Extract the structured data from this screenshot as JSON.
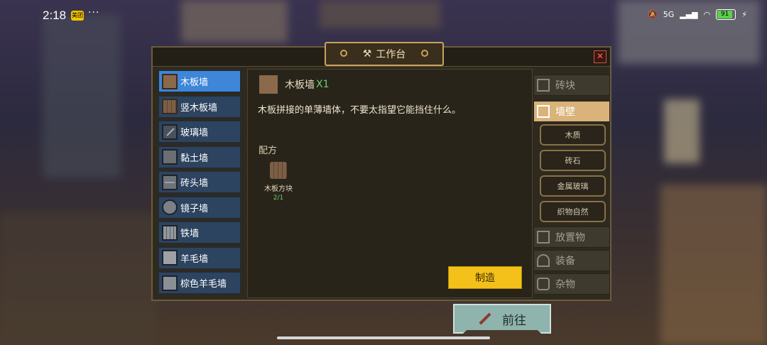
{
  "status_bar": {
    "time": "2:18",
    "app_badge": "美团",
    "more": "···",
    "network": "5G",
    "battery": "91"
  },
  "panel": {
    "title": "工作台",
    "close": "✕"
  },
  "wall_list": [
    {
      "label": "木板墙",
      "icon": "wood-wall-icon",
      "selected": true
    },
    {
      "label": "竖木板墙",
      "icon": "vertical-wood-wall-icon",
      "selected": false
    },
    {
      "label": "玻璃墙",
      "icon": "glass-wall-icon",
      "selected": false
    },
    {
      "label": "黏土墙",
      "icon": "clay-wall-icon",
      "selected": false
    },
    {
      "label": "砖头墙",
      "icon": "brick-wall-icon",
      "selected": false
    },
    {
      "label": "镜子墙",
      "icon": "mirror-wall-icon",
      "selected": false
    },
    {
      "label": "铁墙",
      "icon": "iron-wall-icon",
      "selected": false
    },
    {
      "label": "羊毛墙",
      "icon": "wool-wall-icon",
      "selected": false
    },
    {
      "label": "棕色羊毛墙",
      "icon": "brown-wool-wall-icon",
      "selected": false
    }
  ],
  "detail": {
    "name": "木板墙",
    "quantity": "X1",
    "description": "木板拼接的单薄墙体，不要太指望它能挡住什么。",
    "recipe_label": "配方",
    "ingredients": [
      {
        "name": "木板方块",
        "count": "2/1"
      }
    ],
    "craft_button": "制造"
  },
  "categories": {
    "bricks": "砖块",
    "walls": "墙壁",
    "wall_subs": [
      "木质",
      "砖石",
      "金属玻璃",
      "织物自然"
    ],
    "placeables": "放置物",
    "equipment": "装备",
    "misc": "杂物"
  },
  "go_button": "前往",
  "colors": {
    "selected_item": "#3d86d8",
    "craft": "#f3c11a",
    "quantity_green": "#69d06c",
    "selected_category": "#d9b37a"
  }
}
